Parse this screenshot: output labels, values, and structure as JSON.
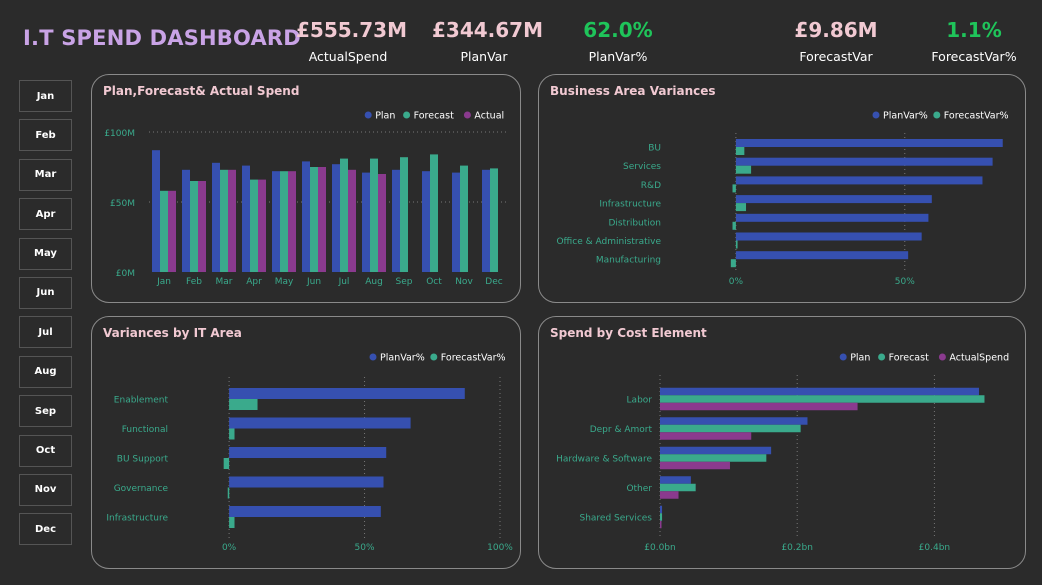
{
  "header": {
    "title": "I.T SPEND DASHBOARD"
  },
  "kpis": [
    {
      "value": "£555.73M",
      "label": "ActualSpend",
      "color": "#f1c9d2"
    },
    {
      "value": "£344.67M",
      "label": "PlanVar",
      "color": "#f1c9d2"
    },
    {
      "value": "62.0%",
      "label": "PlanVar%",
      "color": "#1fc45a"
    },
    {
      "value": "£9.86M",
      "label": "ForecastVar",
      "color": "#f1c9d2"
    },
    {
      "value": "1.1%",
      "label": "ForecastVar%",
      "color": "#1fc45a"
    }
  ],
  "months": [
    "Jan",
    "Feb",
    "Mar",
    "Apr",
    "May",
    "Jun",
    "Jul",
    "Aug",
    "Sep",
    "Oct",
    "Nov",
    "Dec"
  ],
  "colors": {
    "plan": "#3650b0",
    "forecast": "#3aaa8c",
    "actual": "#8a3a8e",
    "axis_text": "#3aaa8c"
  },
  "chart_data": [
    {
      "id": "spend",
      "type": "bar",
      "title": "Plan,Forecast& Actual Spend",
      "categories": [
        "Jan",
        "Feb",
        "Mar",
        "Apr",
        "May",
        "Jun",
        "Jul",
        "Aug",
        "Sep",
        "Oct",
        "Nov",
        "Dec"
      ],
      "series": [
        {
          "name": "Plan",
          "values": [
            87,
            73,
            78,
            76,
            72,
            79,
            77,
            71,
            73,
            72,
            71,
            73
          ]
        },
        {
          "name": "Forecast",
          "values": [
            58,
            65,
            73,
            66,
            72,
            75,
            81,
            81,
            82,
            84,
            76,
            74
          ]
        },
        {
          "name": "Actual",
          "values": [
            58,
            65,
            73,
            66,
            72,
            75,
            73,
            70,
            null,
            null,
            null,
            null
          ]
        }
      ],
      "ylim": [
        0,
        100
      ],
      "yticks": [
        "£0M",
        "£50M",
        "£100M"
      ],
      "legend": "top-right",
      "grid": true
    },
    {
      "id": "business",
      "type": "bar",
      "title": "Business Area Variances",
      "orientation": "horizontal",
      "categories": [
        "BU",
        "Services",
        "R&D",
        "Infrastructure",
        "Distribution",
        "Office & Administrative",
        "Manufacturing"
      ],
      "series": [
        {
          "name": "PlanVar%",
          "values": [
            79,
            76,
            73,
            58,
            57,
            55,
            51
          ]
        },
        {
          "name": "ForecastVar%",
          "values": [
            2.5,
            4.5,
            -1,
            3,
            -1,
            0.5,
            -1.5
          ]
        }
      ],
      "xticks": [
        "0%",
        "50%"
      ],
      "xlim": [
        -5,
        85
      ],
      "legend": "top-right",
      "grid": true
    },
    {
      "id": "itarea",
      "type": "bar",
      "title": "Variances by IT Area",
      "orientation": "horizontal",
      "categories": [
        "Enablement",
        "Functional",
        "BU Support",
        "Governance",
        "Infrastructure"
      ],
      "series": [
        {
          "name": "PlanVar%",
          "values": [
            87,
            67,
            58,
            57,
            56
          ]
        },
        {
          "name": "ForecastVar%",
          "values": [
            10.5,
            2,
            -2,
            -0.5,
            2
          ]
        }
      ],
      "xticks": [
        "0%",
        "50%",
        "100%"
      ],
      "xlim": [
        -10,
        100
      ],
      "legend": "top-right",
      "grid": true
    },
    {
      "id": "cost",
      "type": "bar",
      "title": "Spend by Cost Element",
      "orientation": "horizontal",
      "categories": [
        "Labor",
        "Depr & Amort",
        "Hardware & Software",
        "Other",
        "Shared Services"
      ],
      "series": [
        {
          "name": "Plan",
          "values": [
            0.465,
            0.215,
            0.162,
            0.045,
            0.003
          ]
        },
        {
          "name": "Forecast",
          "values": [
            0.473,
            0.205,
            0.155,
            0.052,
            0.003
          ]
        },
        {
          "name": "ActualSpend",
          "values": [
            0.288,
            0.133,
            0.102,
            0.027,
            0.001
          ]
        }
      ],
      "xticks": [
        "£0.0bn",
        "£0.2bn",
        "£0.4bn"
      ],
      "xlim": [
        0,
        0.5
      ],
      "legend": "top-right",
      "grid": true
    }
  ]
}
